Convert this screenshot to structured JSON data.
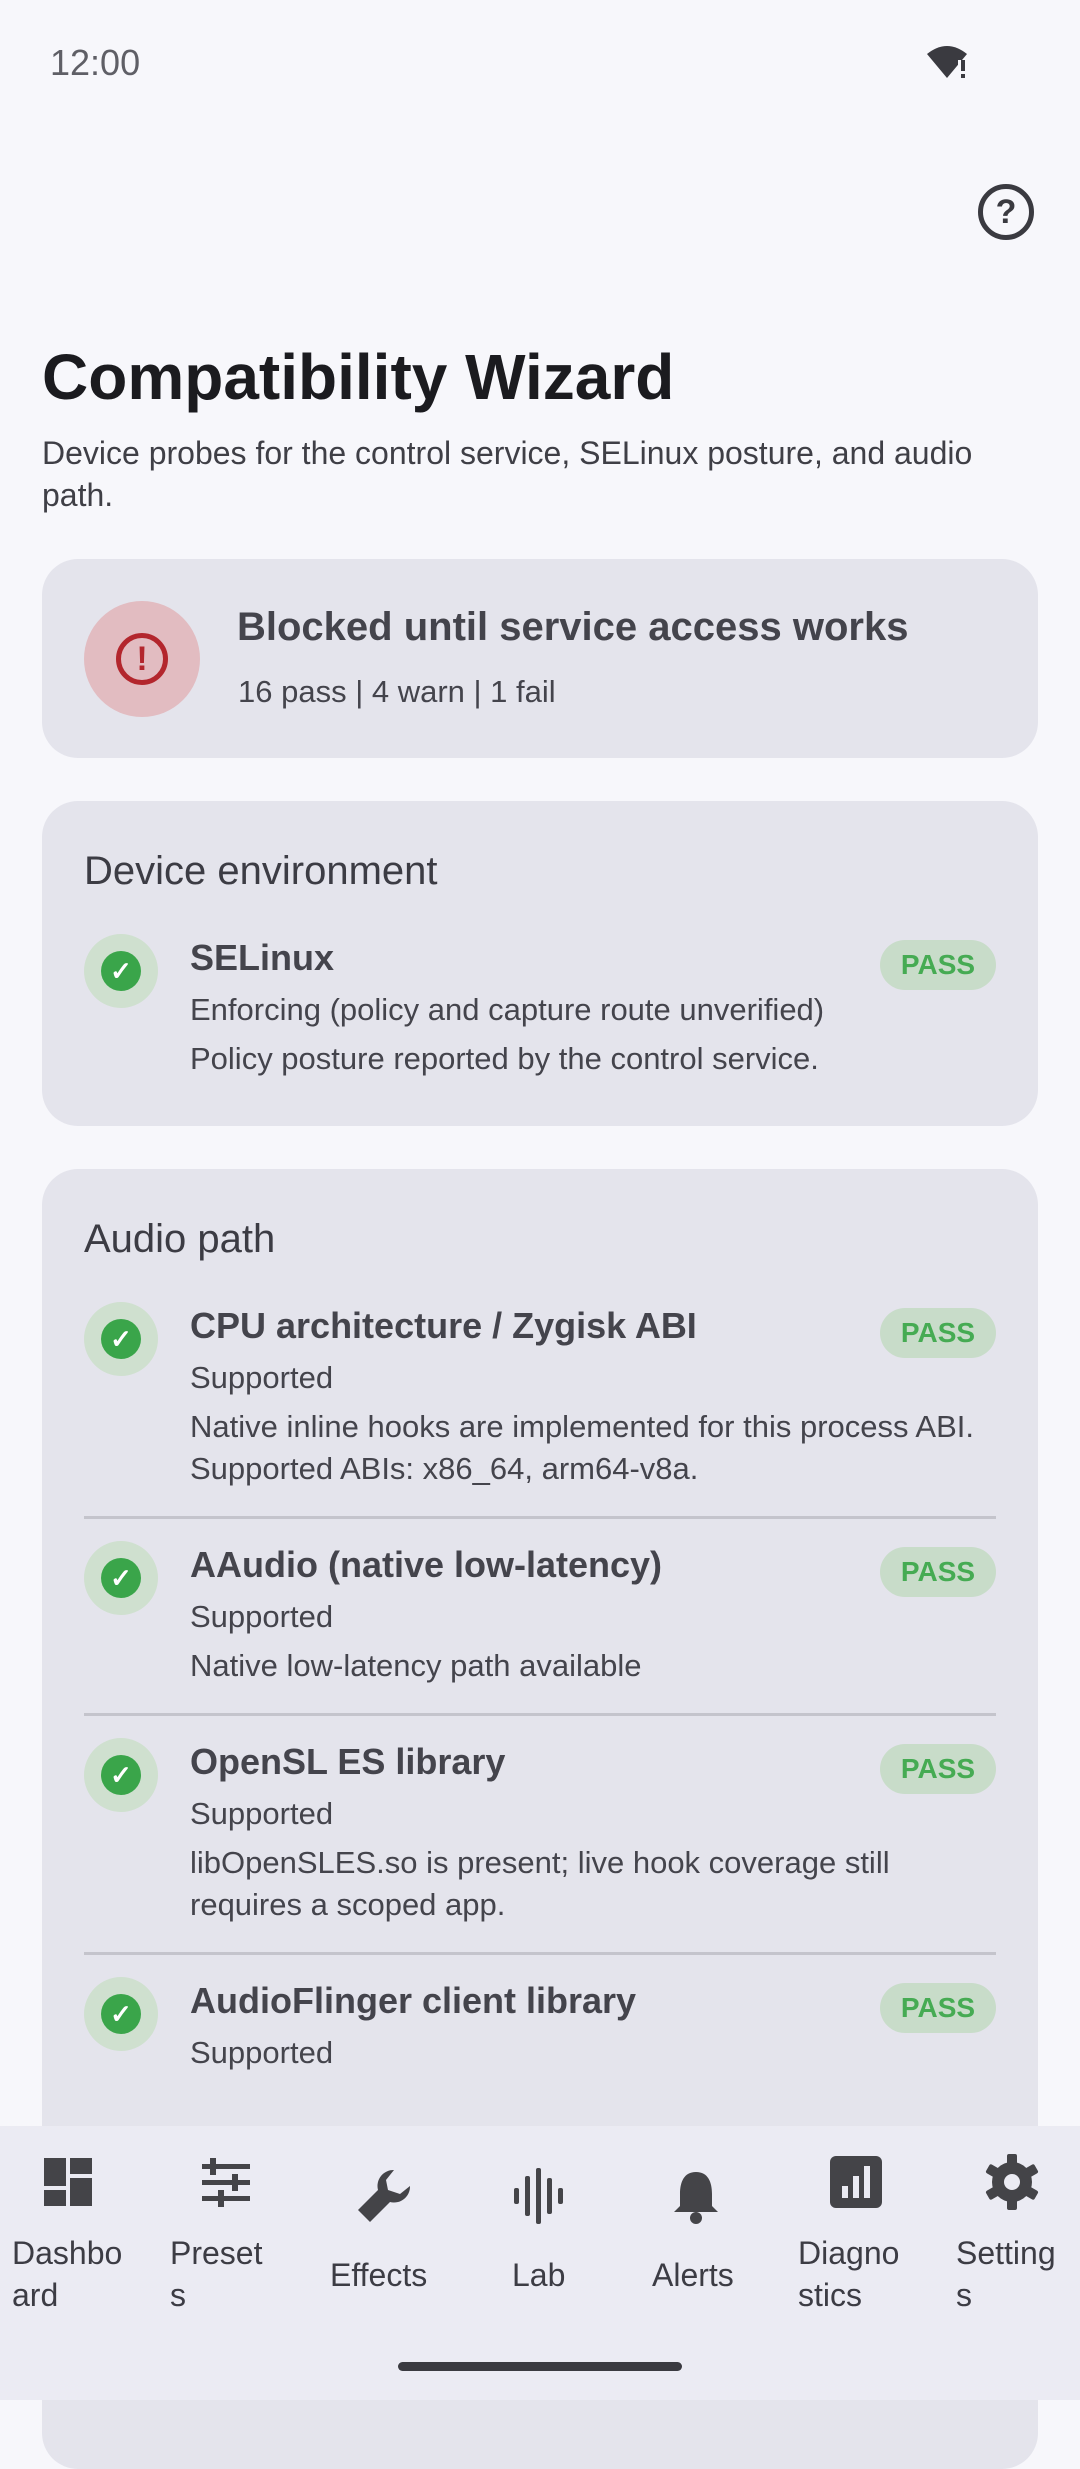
{
  "status_bar": {
    "time": "12:00",
    "wifi_icon": "wifi-alert-icon"
  },
  "header": {
    "help_icon": "help-circle-icon",
    "help_label": "?"
  },
  "page": {
    "title": "Compatibility Wizard",
    "subtitle": "Device probes for the control service, SELinux posture, and audio path."
  },
  "summary": {
    "icon": "error-icon",
    "icon_glyph": "!",
    "title": "Blocked until service access works",
    "counts": "16 pass | 4 warn | 1 fail"
  },
  "sections": {
    "device_environment": {
      "title": "Device environment",
      "checks": [
        {
          "name": "SELinux",
          "status": "Enforcing (policy and capture route unverified)",
          "detail": "Policy posture reported by the control service.",
          "badge": "PASS"
        }
      ]
    },
    "audio_path": {
      "title": "Audio path",
      "checks": [
        {
          "name": "CPU architecture / Zygisk ABI",
          "status": "Supported",
          "detail": "Native inline hooks are implemented for this process ABI. Supported ABIs: x86_64, arm64-v8a.",
          "badge": "PASS"
        },
        {
          "name": "AAudio (native low-latency)",
          "status": "Supported",
          "detail": "Native low-latency path available",
          "badge": "PASS"
        },
        {
          "name": "OpenSL ES library",
          "status": "Supported",
          "detail": "libOpenSLES.so is present; live hook coverage still requires a scoped app.",
          "badge": "PASS"
        },
        {
          "name": "AudioFlinger client library",
          "status": "Supported",
          "detail": "",
          "badge": "PASS"
        }
      ]
    }
  },
  "check_icon_glyph": "✓",
  "bottom_nav": [
    {
      "label_line1": "Dashbo",
      "label_line2": "ard",
      "icon": "dashboard-icon"
    },
    {
      "label_line1": "Preset",
      "label_line2": "s",
      "icon": "tune-sliders-icon"
    },
    {
      "label_line1": "Effects",
      "label_line2": "",
      "icon": "wrench-icon"
    },
    {
      "label_line1": "Lab",
      "label_line2": "",
      "icon": "waveform-icon"
    },
    {
      "label_line1": "Alerts",
      "label_line2": "",
      "icon": "bell-icon"
    },
    {
      "label_line1": "Diagno",
      "label_line2": "stics",
      "icon": "bar-chart-icon"
    },
    {
      "label_line1": "Setting",
      "label_line2": "s",
      "icon": "gear-icon"
    }
  ],
  "colors": {
    "pass": "#46ab53",
    "fail": "#b3262d",
    "card": "#e4e4ec",
    "background": "#f7f7fb"
  }
}
